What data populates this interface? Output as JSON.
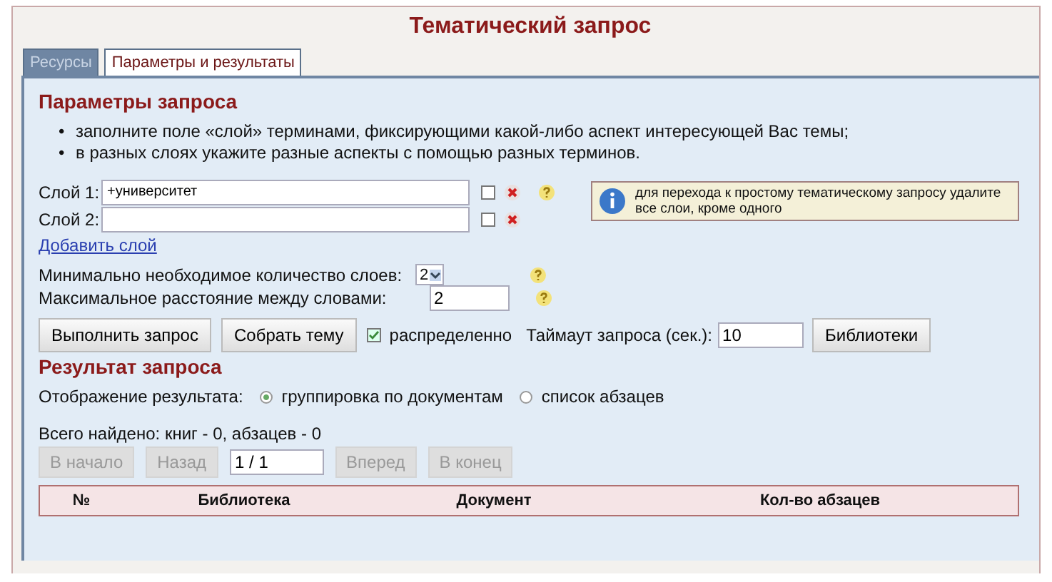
{
  "title": "Тематический запрос",
  "tabs": [
    {
      "label": "Ресурсы",
      "selected": false
    },
    {
      "label": "Параметры и результаты",
      "selected": true
    }
  ],
  "params": {
    "heading": "Параметры запроса",
    "hints": [
      {
        "marker": "•",
        "text": "заполните поле «слой» терминами, фиксирующими какой-либо аспект интересующей Вас темы;"
      },
      {
        "marker": "•",
        "text": "в разных слоях укажите разные аспекты с помощью разных терминов."
      }
    ],
    "layers": [
      {
        "label": "Слой 1:",
        "value": "+университет",
        "checked": false,
        "help": true
      },
      {
        "label": "Слой 2:",
        "checked": false,
        "help": false
      }
    ],
    "info": "для перехода к простому тематическому запросу удалите все слои, кроме одного",
    "add_layer": "Добавить слой",
    "min_layers": {
      "label": "Минимально необходимое количество слоев:",
      "value": "2"
    },
    "max_distance": {
      "label": "Максимальное расстояние между словами:",
      "value": "2"
    },
    "buttons": [
      "Выполнить запрос",
      "Собрать тему"
    ],
    "distributed": {
      "label": "распределенно",
      "checked": true
    },
    "timeout": {
      "label": "Таймаут запроса (сек.):",
      "value": "10"
    },
    "libraries_button": "Библиотеки"
  },
  "result": {
    "heading": "Результат запроса",
    "display_label": "Отображение результата:",
    "display_options": [
      {
        "label": "группировка по документам",
        "selected": true
      },
      {
        "label": "список абзацев",
        "selected": false
      }
    ],
    "found": "Всего найдено: книг - 0,   абзацев - 0",
    "pager": [
      {
        "label": "В начало",
        "disabled": true
      },
      {
        "label": "Назад",
        "disabled": true
      }
    ],
    "page": "1 / 1",
    "pager_next": [
      {
        "label": "Вперед",
        "disabled": true
      },
      {
        "label": "В конец",
        "disabled": true
      }
    ],
    "columns": [
      "№",
      "Библиотека",
      "Документ",
      "Кол-во абзацев"
    ]
  }
}
